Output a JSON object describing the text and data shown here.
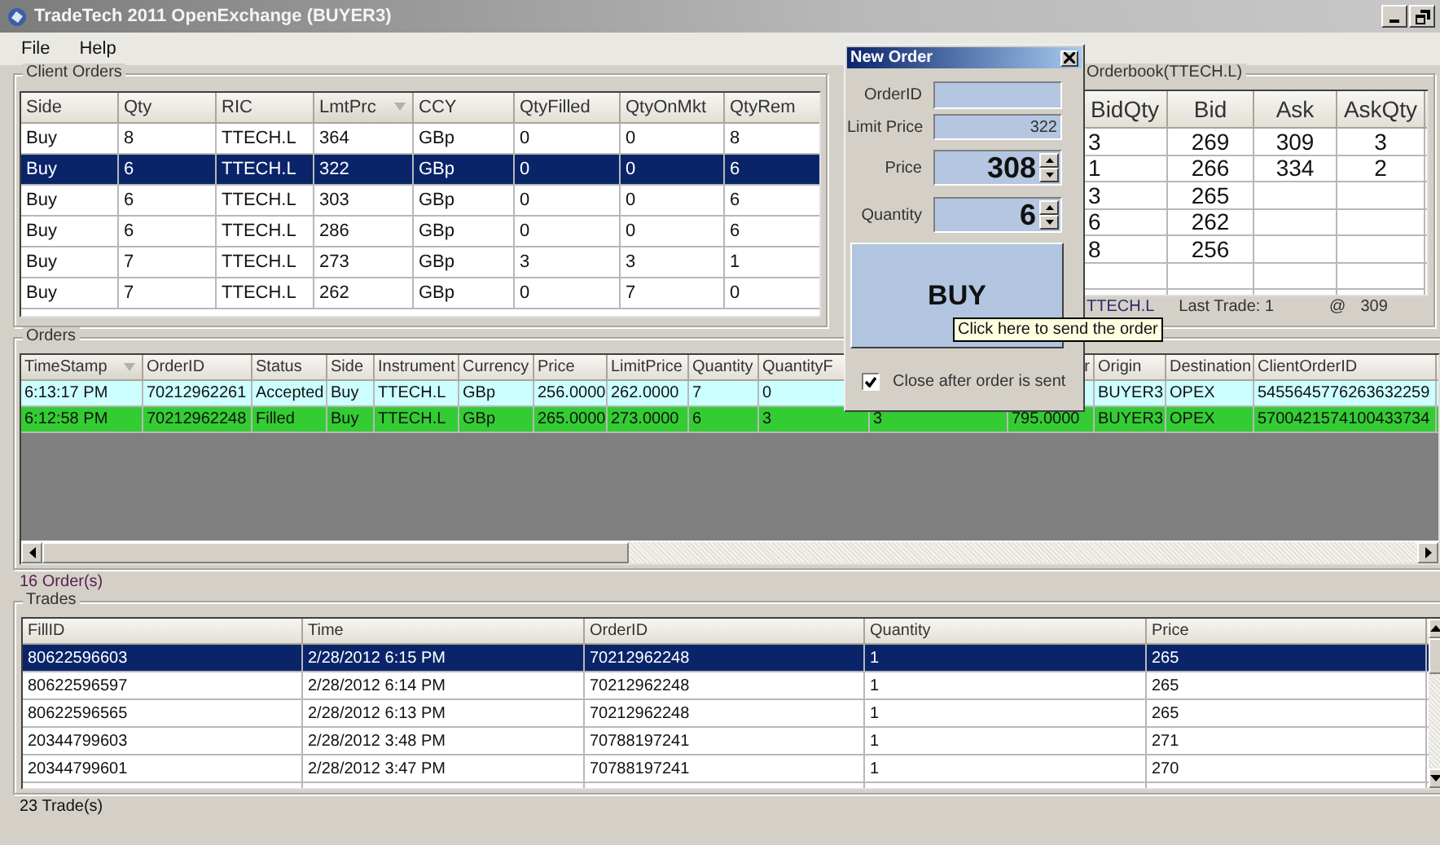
{
  "window": {
    "title": "TradeTech 2011 OpenExchange (BUYER3)"
  },
  "menu": [
    "File",
    "Help"
  ],
  "client_orders": {
    "title": "Client Orders",
    "columns": [
      {
        "label": "Side",
        "sorted": false
      },
      {
        "label": "Qty",
        "sorted": false
      },
      {
        "label": "RIC",
        "sorted": false
      },
      {
        "label": "LmtPrc",
        "sorted": true
      },
      {
        "label": "CCY",
        "sorted": false
      },
      {
        "label": "QtyFilled",
        "sorted": false
      },
      {
        "label": "QtyOnMkt",
        "sorted": false
      },
      {
        "label": "QtyRem",
        "sorted": false
      }
    ],
    "rows": [
      {
        "selected": false,
        "cells": [
          "Buy",
          "8",
          "TTECH.L",
          "364",
          "GBp",
          "0",
          "0",
          "8"
        ]
      },
      {
        "selected": true,
        "cells": [
          "Buy",
          "6",
          "TTECH.L",
          "322",
          "GBp",
          "0",
          "0",
          "6"
        ]
      },
      {
        "selected": false,
        "cells": [
          "Buy",
          "6",
          "TTECH.L",
          "303",
          "GBp",
          "0",
          "0",
          "6"
        ]
      },
      {
        "selected": false,
        "cells": [
          "Buy",
          "6",
          "TTECH.L",
          "286",
          "GBp",
          "0",
          "0",
          "6"
        ]
      },
      {
        "selected": false,
        "cells": [
          "Buy",
          "7",
          "TTECH.L",
          "273",
          "GBp",
          "3",
          "3",
          "1"
        ]
      },
      {
        "selected": false,
        "cells": [
          "Buy",
          "7",
          "TTECH.L",
          "262",
          "GBp",
          "0",
          "7",
          "0"
        ]
      }
    ]
  },
  "orderbook": {
    "title": "Orderbook(TTECH.L)",
    "columns": [
      "BidQty",
      "Bid",
      "Ask",
      "AskQty"
    ],
    "rows": [
      [
        "3",
        "269",
        "309",
        "3"
      ],
      [
        "1",
        "266",
        "334",
        "2"
      ],
      [
        "3",
        "265",
        null,
        null
      ],
      [
        "6",
        "262",
        null,
        null
      ],
      [
        "8",
        "256",
        null,
        null
      ]
    ],
    "footer": {
      "symbol": "TTECH.L",
      "last_trade": "Last Trade: 1",
      "at": "@",
      "price": "309"
    }
  },
  "orders": {
    "title": "Orders",
    "columns": [
      {
        "label": "TimeStamp",
        "sorted": true
      },
      {
        "label": "OrderID",
        "sorted": false
      },
      {
        "label": "Status",
        "sorted": false
      },
      {
        "label": "Side",
        "sorted": false
      },
      {
        "label": "Instrument",
        "sorted": false
      },
      {
        "label": "Currency",
        "sorted": false
      },
      {
        "label": "Price",
        "sorted": false
      },
      {
        "label": "LimitPrice",
        "sorted": false
      },
      {
        "label": "Quantity",
        "sorted": false
      },
      {
        "label": "QuantityF"
      },
      {},
      {
        "label": "r"
      },
      {
        "label": "Origin",
        "sorted": false
      },
      {
        "label": "Destination",
        "sorted": false
      },
      {
        "label": "ClientOrderID",
        "sorted": false
      }
    ],
    "rows": [
      {
        "color": "#ccffff",
        "cells": [
          "6:13:17 PM",
          "70212962261",
          "Accepted",
          "Buy",
          "TTECH.L",
          "GBp",
          "256.0000",
          "262.0000",
          "7",
          "0",
          null,
          null,
          "BUYER3",
          "OPEX",
          "5455645776263632259"
        ]
      },
      {
        "color": "#33cc33",
        "cells": [
          "6:12:58 PM",
          "70212962248",
          "Filled",
          "Buy",
          "TTECH.L",
          "GBp",
          "265.0000",
          "273.0000",
          "6",
          "3",
          "3",
          "795.0000",
          "BUYER3",
          "OPEX",
          "5700421574100433734"
        ]
      }
    ],
    "count": "16 Order(s)"
  },
  "new_order": {
    "title": "New Order",
    "fields": [
      {
        "kind": "text",
        "label": "OrderID"
      },
      {
        "kind": "text",
        "label": "Limit Price",
        "value": "322"
      },
      {
        "kind": "spinner",
        "label": "Price",
        "value": "308"
      },
      {
        "kind": "spinner",
        "label": "Quantity",
        "value": "6"
      }
    ],
    "button": "BUY",
    "tooltip": "Click here to send the order",
    "checkbox": {
      "label": "Close after order is sent",
      "checked": true
    }
  },
  "trades": {
    "title": "Trades",
    "columns": [
      "FillID",
      "Time",
      "OrderID",
      "Quantity",
      "Price"
    ],
    "rows": [
      {
        "selected": true,
        "cells": [
          "80622596603",
          "2/28/2012 6:15 PM",
          "70212962248",
          "1",
          "265"
        ]
      },
      {
        "selected": false,
        "cells": [
          "80622596597",
          "2/28/2012 6:14 PM",
          "70212962248",
          "1",
          "265"
        ]
      },
      {
        "selected": false,
        "cells": [
          "80622596565",
          "2/28/2012 6:13 PM",
          "70212962248",
          "1",
          "265"
        ]
      },
      {
        "selected": false,
        "cells": [
          "20344799603",
          "2/28/2012 3:48 PM",
          "70788197241",
          "1",
          "271"
        ]
      },
      {
        "selected": false,
        "cells": [
          "20344799601",
          "2/28/2012 3:47 PM",
          "70788197241",
          "1",
          "270"
        ]
      }
    ],
    "count": "23 Trade(s)"
  }
}
